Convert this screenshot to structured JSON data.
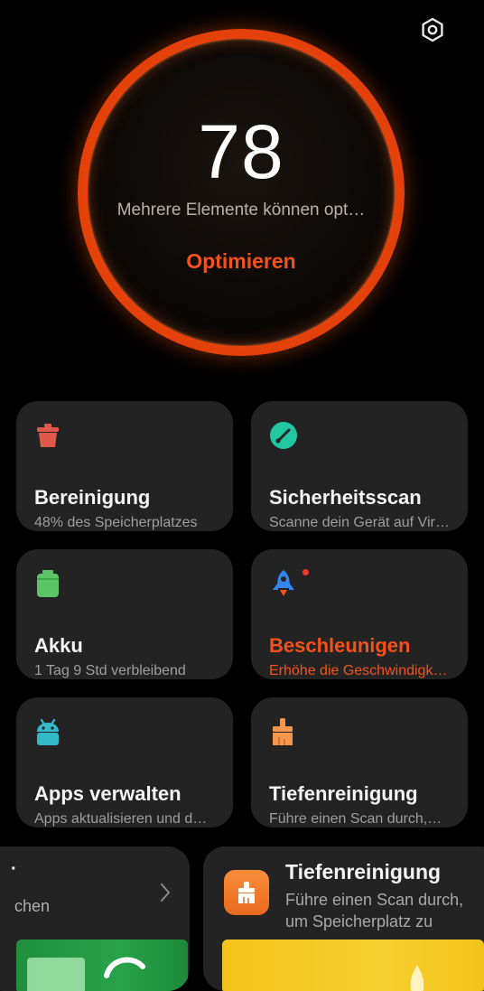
{
  "header": {
    "settings_icon": "hexagon-gear-icon"
  },
  "score": {
    "value": "78",
    "status": "Mehrere Elemente können opt…",
    "action_label": "Optimieren",
    "ring_color": "#f4521a"
  },
  "cards": [
    {
      "title": "Bereinigung",
      "subtitle": "48% des Speicherplatzes",
      "icon": "trash-icon",
      "icon_color": "#e0584a"
    },
    {
      "title": "Sicherheitsscan",
      "subtitle": "Scanne dein Gerät auf Vir…",
      "icon": "shield-scan-icon",
      "icon_color": "#21c7a1"
    },
    {
      "title": "Akku",
      "subtitle": "1 Tag 9 Std  verbleibend",
      "icon": "battery-icon",
      "icon_color": "#5cc567"
    },
    {
      "title": "Beschleunigen",
      "subtitle": "Erhöhe die Geschwindigk…",
      "icon": "rocket-icon",
      "icon_color": "#3585f0",
      "accent": true
    },
    {
      "title": "Apps verwalten",
      "subtitle": "Apps aktualisieren und d…",
      "icon": "android-icon",
      "icon_color": "#33b8c8"
    },
    {
      "title": "Tiefenreinigung",
      "subtitle": "Führe einen Scan durch,…",
      "icon": "brush-icon",
      "icon_color": "#f4974a"
    }
  ],
  "bottom": {
    "left": {
      "title_fragment": "·",
      "text_fragment": "chen",
      "chevron_icon": "chevron-right-icon"
    },
    "right": {
      "title": "Tiefenreinigung",
      "description": "Führe einen Scan durch, um Speicherplatz zu sparen",
      "icon": "brush-icon"
    }
  }
}
